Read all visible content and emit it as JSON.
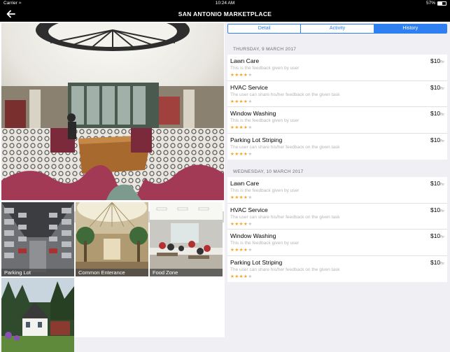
{
  "status": {
    "carrier": "Carrier",
    "time": "10:24 AM",
    "battery": "57%"
  },
  "nav": {
    "title": "SAN ANTONIO MARKETPLACE",
    "back_icon": "arrow-left-icon"
  },
  "gallery": {
    "page_count": 4,
    "active_page": 3,
    "tiles": [
      {
        "caption": "Parking Lot"
      },
      {
        "caption": "Common Enterance"
      },
      {
        "caption": "Food Zone"
      },
      {
        "caption": ""
      }
    ]
  },
  "tabs": {
    "items": [
      "Detail",
      "Activity",
      "History"
    ],
    "selected": "History"
  },
  "history": [
    {
      "date": "THURSDAY, 9 MARCH 2017",
      "entries": [
        {
          "name": "Lawn Care",
          "feedback": "This is the feedback given by user",
          "price": "$10",
          "unit": "/hr",
          "rating": 4
        },
        {
          "name": "HVAC Service",
          "feedback": "The user can share his/her feedback on the given task",
          "price": "$10",
          "unit": "/hr",
          "rating": 4
        },
        {
          "name": "Window Washing",
          "feedback": "This is the feedback given by user",
          "price": "$10",
          "unit": "/hr",
          "rating": 4
        },
        {
          "name": "Parking Lot Striping",
          "feedback": "The user can share his/her feedback on the given task",
          "price": "$10",
          "unit": "/hr",
          "rating": 4
        }
      ]
    },
    {
      "date": "WEDNESDAY, 10 MARCH 2017",
      "entries": [
        {
          "name": "Lawn Care",
          "feedback": "This is the feedback given by user",
          "price": "$10",
          "unit": "/hr",
          "rating": 4
        },
        {
          "name": "HVAC Service",
          "feedback": "The user can share his/her feedback on the given task",
          "price": "$10",
          "unit": "/hr",
          "rating": 4
        },
        {
          "name": "Window Washing",
          "feedback": "This is the feedback given by user",
          "price": "$10",
          "unit": "/hr",
          "rating": 4
        },
        {
          "name": "Parking Lot Striping",
          "feedback": "The user can share his/her feedback on the given task",
          "price": "$10",
          "unit": "/hr",
          "rating": 4
        }
      ]
    }
  ]
}
